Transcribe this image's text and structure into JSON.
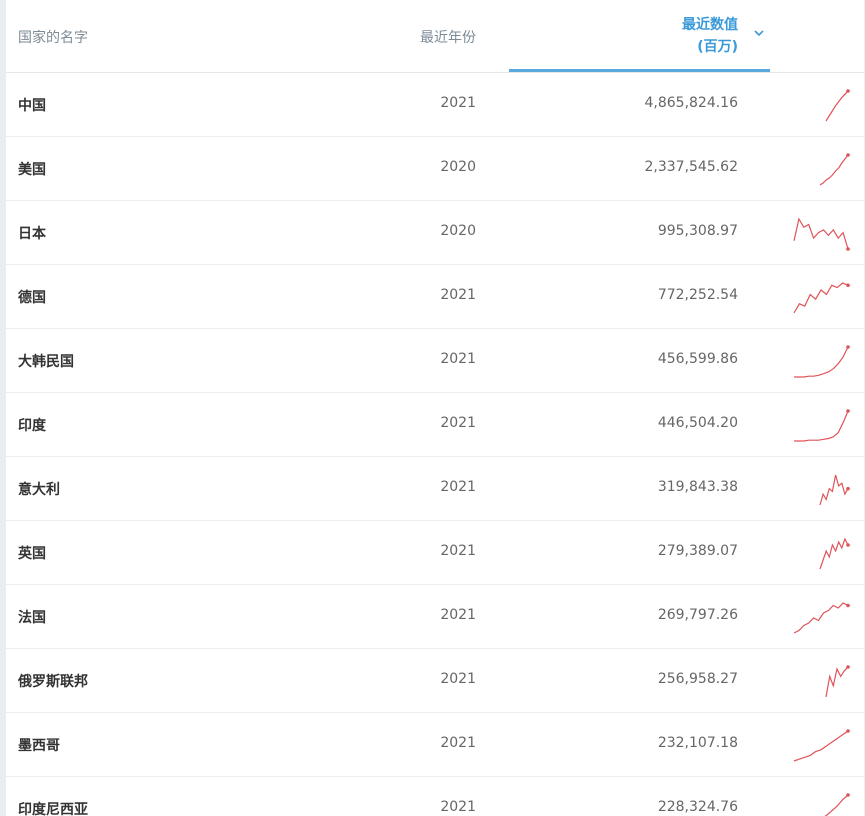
{
  "header": {
    "country": "国家的名字",
    "year": "最近年份",
    "value_line1": "最近数值",
    "value_line2": "(百万)"
  },
  "rows": [
    {
      "country": "中国",
      "year": "2021",
      "value": "4,865,824.16",
      "spark": [
        8,
        14,
        20,
        26,
        31,
        36,
        40,
        44
      ]
    },
    {
      "country": "美国",
      "year": "2020",
      "value": "2,337,545.62",
      "spark": [
        10,
        12,
        15,
        17,
        20,
        24,
        27,
        32,
        36,
        40
      ]
    },
    {
      "country": "日本",
      "year": "2020",
      "value": "995,308.97",
      "spark": [
        28,
        44,
        38,
        40,
        30,
        34,
        36,
        32,
        36,
        30,
        34,
        22
      ]
    },
    {
      "country": "德国",
      "year": "2021",
      "value": "772,252.54",
      "spark": [
        14,
        22,
        20,
        30,
        26,
        34,
        30,
        38,
        36,
        40,
        38
      ]
    },
    {
      "country": "大韩民国",
      "year": "2021",
      "value": "456,599.86",
      "spark": [
        4,
        4,
        4,
        5,
        5,
        6,
        8,
        10,
        14,
        20,
        28,
        40
      ]
    },
    {
      "country": "印度",
      "year": "2021",
      "value": "446,504.20",
      "spark": [
        4,
        4,
        4,
        5,
        5,
        5,
        6,
        7,
        9,
        14,
        26,
        40
      ]
    },
    {
      "country": "意大利",
      "year": "2021",
      "value": "319,843.38",
      "spark": [
        18,
        26,
        22,
        30,
        28,
        40,
        32,
        34,
        26,
        30
      ]
    },
    {
      "country": "英国",
      "year": "2021",
      "value": "279,389.07",
      "spark": [
        16,
        22,
        28,
        24,
        32,
        28,
        34,
        30,
        36,
        32
      ]
    },
    {
      "country": "法国",
      "year": "2021",
      "value": "269,797.26",
      "spark": [
        6,
        8,
        12,
        14,
        18,
        16,
        22,
        24,
        28,
        26,
        30,
        28
      ]
    },
    {
      "country": "俄罗斯联邦",
      "year": "2021",
      "value": "256,958.27",
      "spark": [
        8,
        30,
        20,
        38,
        30,
        36,
        40
      ]
    },
    {
      "country": "墨西哥",
      "year": "2021",
      "value": "232,107.18",
      "spark": [
        6,
        8,
        10,
        12,
        16,
        18,
        22,
        26,
        30,
        34,
        38
      ]
    },
    {
      "country": "印度尼西亚",
      "year": "2021",
      "value": "228,324.76",
      "spark": [
        4,
        4,
        5,
        6,
        8,
        12,
        16,
        22,
        28,
        36,
        42
      ]
    }
  ],
  "colors": {
    "accent": "#3a9ad9",
    "spark": "#e0535a",
    "underline": "#5aa9de"
  }
}
